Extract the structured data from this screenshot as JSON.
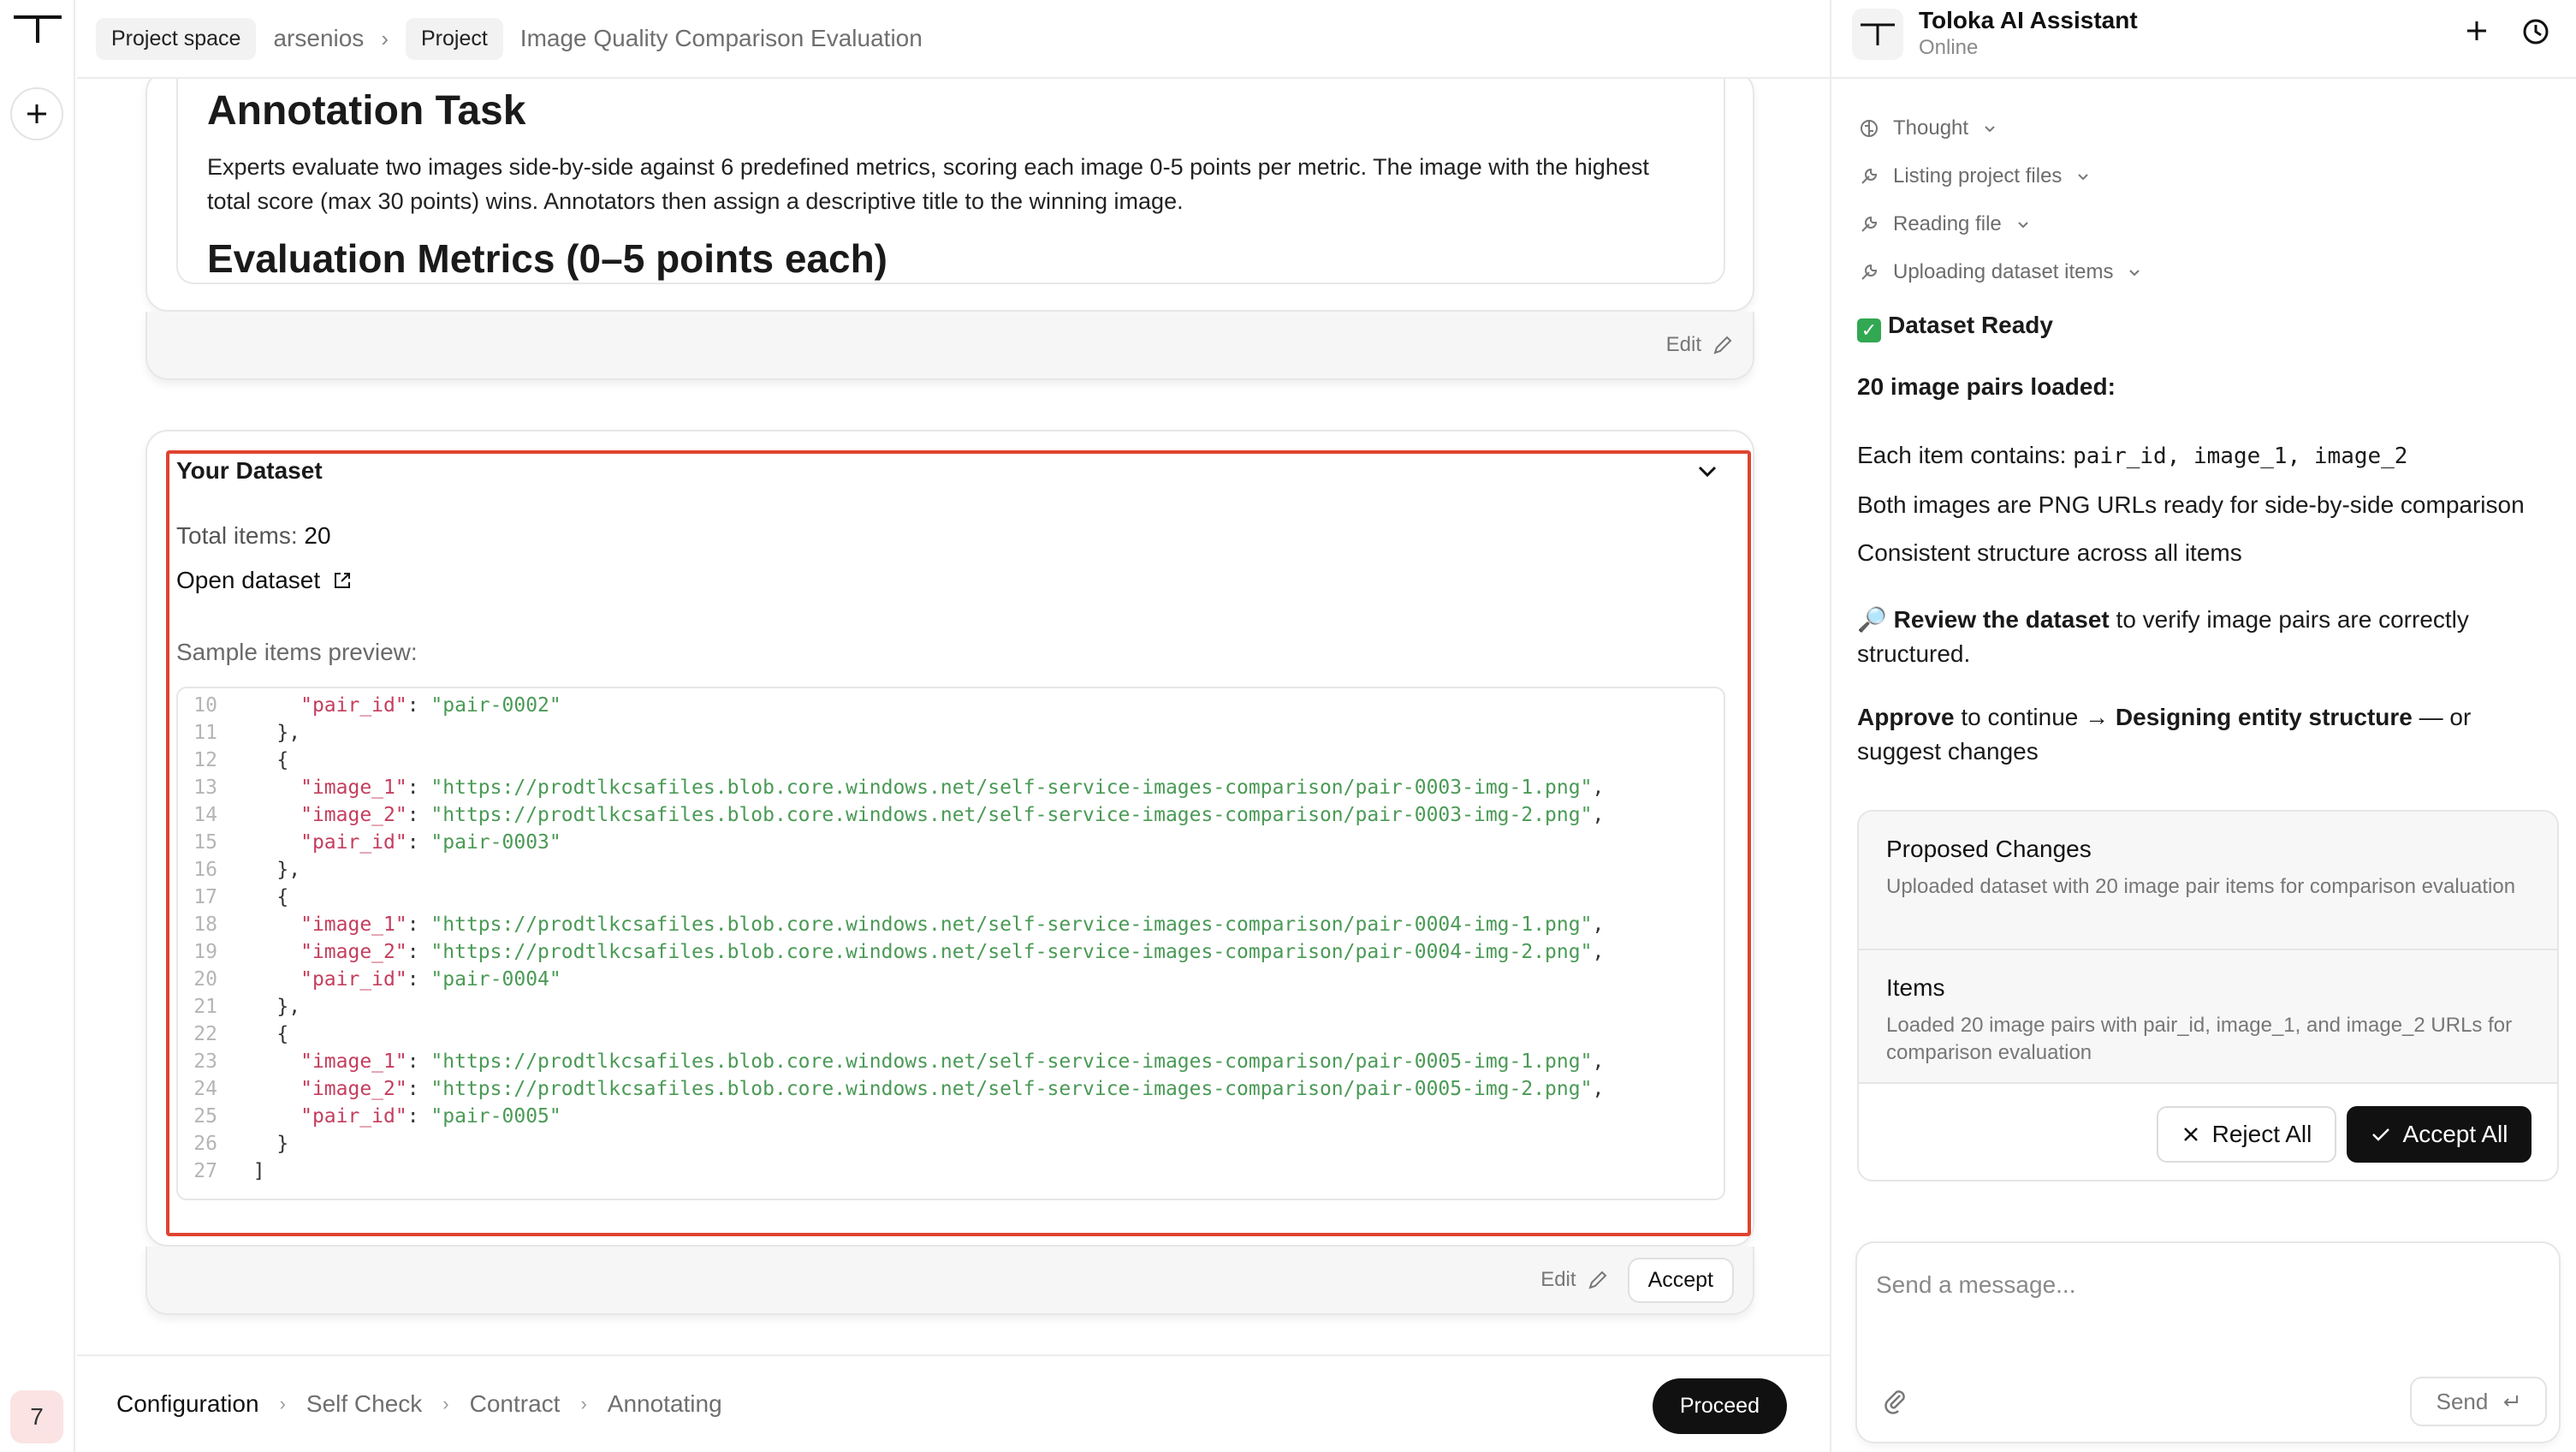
{
  "topbar": {
    "project_space_chip": "Project space",
    "workspace": "arsenios",
    "project_chip": "Project",
    "project_name": "Image Quality Comparison Evaluation"
  },
  "rail": {
    "badge_count": "7"
  },
  "annotation": {
    "title": "Annotation Task",
    "description": "Experts evaluate two images side-by-side against 6 predefined metrics, scoring each image 0-5 points per metric. The image with the highest total score (max 30 points) wins. Annotators then assign a descriptive title to the winning image.",
    "subheading": "Evaluation Metrics (0–5 points each)",
    "edit_label": "Edit"
  },
  "dataset": {
    "title": "Your Dataset",
    "total_label": "Total items:",
    "total_value": "20",
    "open_label": "Open dataset",
    "sample_label": "Sample items preview:",
    "edit_label": "Edit",
    "accept_label": "Accept",
    "code_lines": [
      {
        "n": "10",
        "indent": "      ",
        "key": "\"pair_id\"",
        "val": "\"pair-0002\"",
        "tail": ""
      },
      {
        "n": "11",
        "indent": "    ",
        "text": "},"
      },
      {
        "n": "12",
        "indent": "    ",
        "text": "{"
      },
      {
        "n": "13",
        "indent": "      ",
        "key": "\"image_1\"",
        "val": "\"https://prodtlkcsafiles.blob.core.windows.net/self-service-images-comparison/pair-0003-img-1.png\"",
        "tail": ","
      },
      {
        "n": "14",
        "indent": "      ",
        "key": "\"image_2\"",
        "val": "\"https://prodtlkcsafiles.blob.core.windows.net/self-service-images-comparison/pair-0003-img-2.png\"",
        "tail": ","
      },
      {
        "n": "15",
        "indent": "      ",
        "key": "\"pair_id\"",
        "val": "\"pair-0003\"",
        "tail": ""
      },
      {
        "n": "16",
        "indent": "    ",
        "text": "},"
      },
      {
        "n": "17",
        "indent": "    ",
        "text": "{"
      },
      {
        "n": "18",
        "indent": "      ",
        "key": "\"image_1\"",
        "val": "\"https://prodtlkcsafiles.blob.core.windows.net/self-service-images-comparison/pair-0004-img-1.png\"",
        "tail": ","
      },
      {
        "n": "19",
        "indent": "      ",
        "key": "\"image_2\"",
        "val": "\"https://prodtlkcsafiles.blob.core.windows.net/self-service-images-comparison/pair-0004-img-2.png\"",
        "tail": ","
      },
      {
        "n": "20",
        "indent": "      ",
        "key": "\"pair_id\"",
        "val": "\"pair-0004\"",
        "tail": ""
      },
      {
        "n": "21",
        "indent": "    ",
        "text": "},"
      },
      {
        "n": "22",
        "indent": "    ",
        "text": "{"
      },
      {
        "n": "23",
        "indent": "      ",
        "key": "\"image_1\"",
        "val": "\"https://prodtlkcsafiles.blob.core.windows.net/self-service-images-comparison/pair-0005-img-1.png\"",
        "tail": ","
      },
      {
        "n": "24",
        "indent": "      ",
        "key": "\"image_2\"",
        "val": "\"https://prodtlkcsafiles.blob.core.windows.net/self-service-images-comparison/pair-0005-img-2.png\"",
        "tail": ","
      },
      {
        "n": "25",
        "indent": "      ",
        "key": "\"pair_id\"",
        "val": "\"pair-0005\"",
        "tail": ""
      },
      {
        "n": "26",
        "indent": "    ",
        "text": "}"
      },
      {
        "n": "27",
        "indent": "  ",
        "text": "]"
      }
    ]
  },
  "stepper": {
    "steps": [
      "Configuration",
      "Self Check",
      "Contract",
      "Annotating"
    ],
    "proceed_label": "Proceed"
  },
  "assistant": {
    "name": "Toloka AI Assistant",
    "status": "Online",
    "tools": [
      "Thought",
      "Listing project files",
      "Reading file",
      "Uploading dataset items"
    ],
    "ready_title": "Dataset Ready",
    "loaded_line": "20 image pairs loaded:",
    "contains_prefix": "Each item contains: ",
    "contains_fields": "pair_id, image_1, image_2",
    "png_line": "Both images are PNG URLs ready for side-by-side comparison",
    "consistent_line": "Consistent structure across all items",
    "review_bold": "Review the dataset",
    "review_rest": " to verify image pairs are correctly structured.",
    "approve_bold": "Approve",
    "approve_mid": " to continue → ",
    "approve_bold2": "Designing entity structure",
    "approve_rest": " — or suggest changes",
    "changes": {
      "title": "Proposed Changes",
      "desc": "Uploaded dataset with 20 image pair items for comparison evaluation",
      "items_title": "Items",
      "items_desc": "Loaded 20 image pairs with pair_id, image_1, and image_2 URLs for comparison evaluation",
      "reject_label": "Reject All",
      "accept_label": "Accept All"
    },
    "composer": {
      "placeholder": "Send a message...",
      "send_label": "Send"
    }
  }
}
